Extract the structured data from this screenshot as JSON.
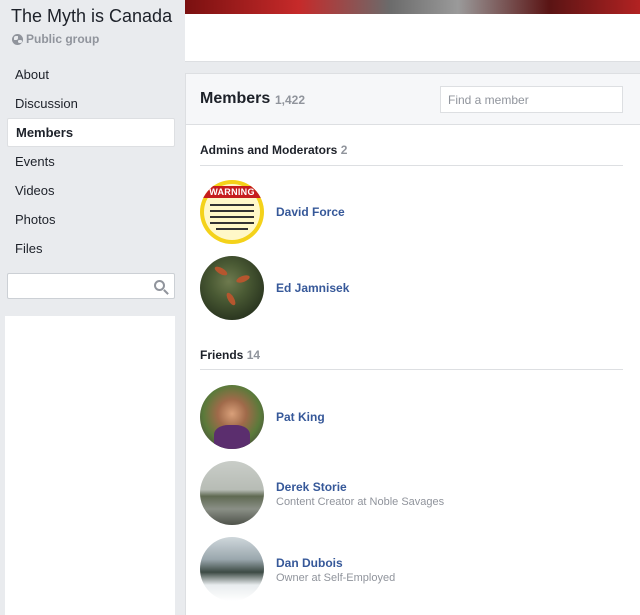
{
  "group": {
    "title": "The Myth is Canada",
    "privacy": "Public group"
  },
  "nav": {
    "items": [
      {
        "label": "About",
        "active": false
      },
      {
        "label": "Discussion",
        "active": false
      },
      {
        "label": "Members",
        "active": true
      },
      {
        "label": "Events",
        "active": false
      },
      {
        "label": "Videos",
        "active": false
      },
      {
        "label": "Photos",
        "active": false
      },
      {
        "label": "Files",
        "active": false
      }
    ]
  },
  "sidebar_search": {
    "value": "",
    "placeholder": ""
  },
  "members": {
    "title": "Members",
    "count": "1,422",
    "find_placeholder": "Find a member",
    "admins_heading": "Admins and Moderators",
    "admins_count": "2",
    "friends_heading": "Friends",
    "friends_count": "14",
    "admins": [
      {
        "name": "David Force",
        "subtitle": "",
        "avatar_text": "WARNING"
      },
      {
        "name": "Ed Jamnisek",
        "subtitle": ""
      }
    ],
    "friends": [
      {
        "name": "Pat King",
        "subtitle": ""
      },
      {
        "name": "Derek Storie",
        "subtitle": "Content Creator at Noble Savages"
      },
      {
        "name": "Dan Dubois",
        "subtitle": "Owner at Self-Employed"
      }
    ]
  },
  "colors": {
    "link": "#365899",
    "muted": "#90949c",
    "background": "#e9ebee"
  }
}
